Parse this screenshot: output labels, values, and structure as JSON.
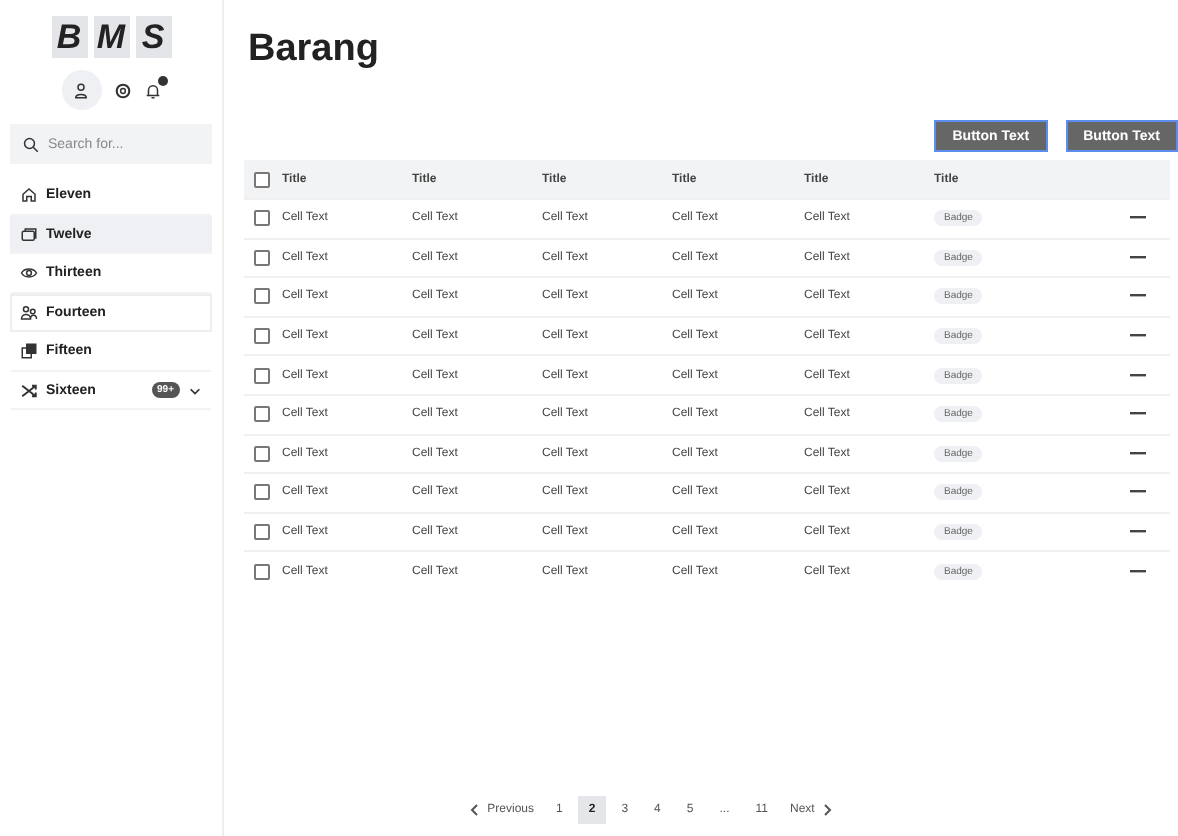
{
  "logo": [
    "B",
    "M",
    "S"
  ],
  "sidebar": {
    "search": {
      "placeholder": "Search for..."
    },
    "items": [
      {
        "label": "Eleven",
        "selected": false,
        "focused": false
      },
      {
        "label": "Twelve",
        "selected": true,
        "focused": false
      },
      {
        "label": "Thirteen",
        "selected": false,
        "focused": false
      },
      {
        "label": "Fourteen",
        "selected": false,
        "focused": true
      },
      {
        "label": "Fifteen",
        "selected": false,
        "focused": false
      },
      {
        "label": "Sixteen",
        "selected": false,
        "focused": false,
        "badge": "99+",
        "expanded": false
      }
    ]
  },
  "page": {
    "title": "Barang",
    "buttons": [
      "Button Text",
      "Button Text"
    ]
  },
  "table": {
    "header_checked": false,
    "columns": [
      "Title",
      "Title",
      "Title",
      "Title",
      "Title",
      "Title"
    ],
    "rows": [
      {
        "checked": false,
        "cells": [
          "Cell Text",
          "Cell Text",
          "Cell Text",
          "Cell Text",
          "Cell Text"
        ],
        "badge": "Badge"
      },
      {
        "checked": false,
        "cells": [
          "Cell Text",
          "Cell Text",
          "Cell Text",
          "Cell Text",
          "Cell Text"
        ],
        "badge": "Badge"
      },
      {
        "checked": false,
        "cells": [
          "Cell Text",
          "Cell Text",
          "Cell Text",
          "Cell Text",
          "Cell Text"
        ],
        "badge": "Badge"
      },
      {
        "checked": false,
        "cells": [
          "Cell Text",
          "Cell Text",
          "Cell Text",
          "Cell Text",
          "Cell Text"
        ],
        "badge": "Badge"
      },
      {
        "checked": false,
        "cells": [
          "Cell Text",
          "Cell Text",
          "Cell Text",
          "Cell Text",
          "Cell Text"
        ],
        "badge": "Badge"
      },
      {
        "checked": false,
        "cells": [
          "Cell Text",
          "Cell Text",
          "Cell Text",
          "Cell Text",
          "Cell Text"
        ],
        "badge": "Badge"
      },
      {
        "checked": false,
        "cells": [
          "Cell Text",
          "Cell Text",
          "Cell Text",
          "Cell Text",
          "Cell Text"
        ],
        "badge": "Badge"
      },
      {
        "checked": false,
        "cells": [
          "Cell Text",
          "Cell Text",
          "Cell Text",
          "Cell Text",
          "Cell Text"
        ],
        "badge": "Badge"
      },
      {
        "checked": false,
        "cells": [
          "Cell Text",
          "Cell Text",
          "Cell Text",
          "Cell Text",
          "Cell Text"
        ],
        "badge": "Badge"
      },
      {
        "checked": false,
        "cells": [
          "Cell Text",
          "Cell Text",
          "Cell Text",
          "Cell Text",
          "Cell Text"
        ],
        "badge": "Badge"
      }
    ]
  },
  "pagination": {
    "previous": "Previous",
    "next": "Next",
    "pages": [
      {
        "label": "1",
        "selected": false
      },
      {
        "label": "2",
        "selected": true
      },
      {
        "label": "3",
        "selected": false
      },
      {
        "label": "4",
        "selected": false
      },
      {
        "label": "5",
        "selected": false
      },
      {
        "label": "...",
        "selected": false
      },
      {
        "label": "11",
        "selected": false
      }
    ]
  }
}
